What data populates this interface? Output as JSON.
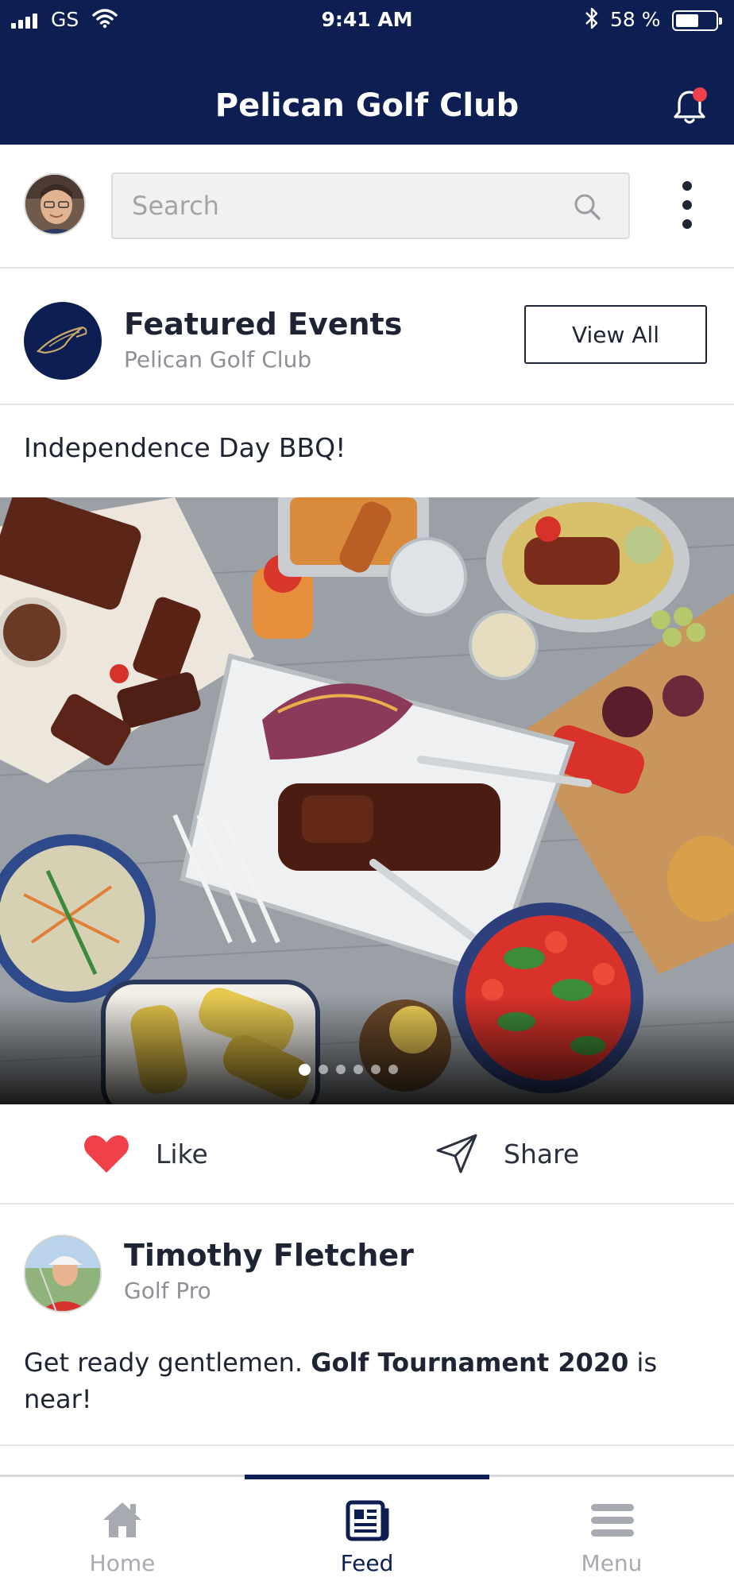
{
  "status_bar": {
    "carrier": "GS",
    "time": "9:41 AM",
    "battery": "58 %"
  },
  "header": {
    "title": "Pelican Golf Club"
  },
  "search": {
    "placeholder": "Search"
  },
  "featured": {
    "title": "Featured Events",
    "subtitle": "Pelican Golf Club",
    "view_all_label": "View All"
  },
  "event": {
    "title": "Independence Day BBQ!",
    "carousel": {
      "total": 6,
      "active_index": 0
    }
  },
  "actions": {
    "like_label": "Like",
    "share_label": "Share"
  },
  "post": {
    "author": "Timothy Fletcher",
    "role": "Golf Pro",
    "text_before": "Get ready gentlemen. ",
    "text_bold": "Golf Tournament 2020",
    "text_after": " is near!"
  },
  "tabs": [
    {
      "label": "Home",
      "icon": "home-icon",
      "active": false
    },
    {
      "label": "Feed",
      "icon": "feed-icon",
      "active": true
    },
    {
      "label": "Menu",
      "icon": "menu-icon",
      "active": false
    }
  ],
  "colors": {
    "brand_navy": "#0c1e52",
    "like_red": "#f0414b",
    "notification_dot": "#f0414b",
    "inactive_tab": "#a7aab0"
  }
}
